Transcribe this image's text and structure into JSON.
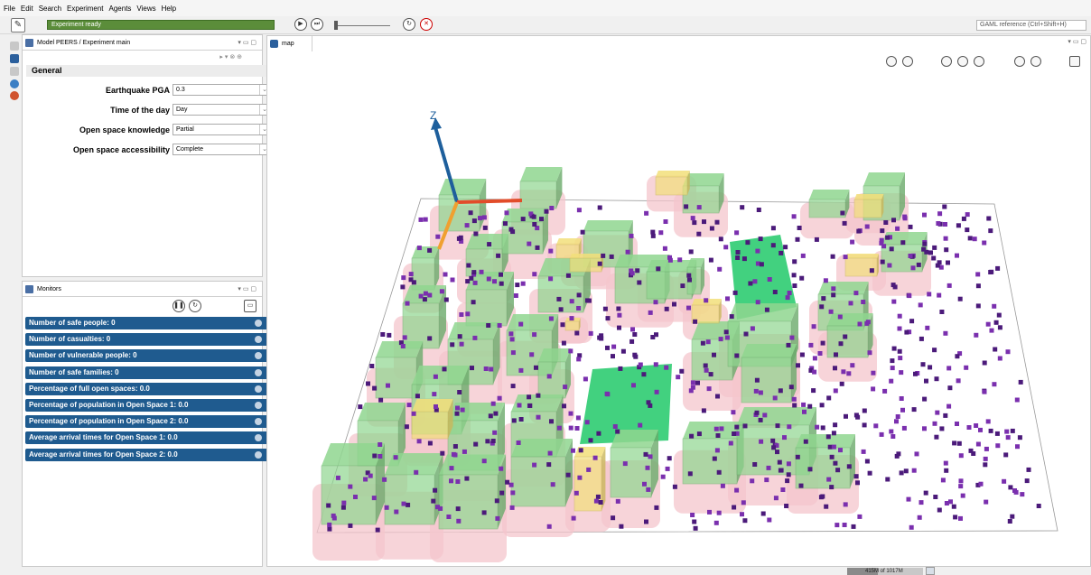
{
  "menubar": [
    "File",
    "Edit",
    "Search",
    "Experiment",
    "Agents",
    "Views",
    "Help"
  ],
  "toolbar": {
    "status": "Experiment ready",
    "search_placeholder": "GAML reference (Ctrl+Shift+H)"
  },
  "params_panel": {
    "title": "Model PEERS / Experiment main",
    "section": "General",
    "params": [
      {
        "label": "Earthquake PGA",
        "value": "0.3"
      },
      {
        "label": "Time of the day",
        "value": "Day"
      },
      {
        "label": "Open space knowledge",
        "value": "Partial"
      },
      {
        "label": "Open space accessibility",
        "value": "Complete"
      }
    ]
  },
  "monitors_panel": {
    "title": "Monitors",
    "items": [
      "Number of safe people:  0",
      "Number of casualties:  0",
      "Number of vulnerable people:  0",
      "Number of safe families:  0",
      "Percentage of full open spaces:  0.0",
      "Percentage of population in Open Space 1:  0.0",
      "Percentage of population in Open Space 2:  0.0",
      "Average arrival times for Open Space 1:  0.0",
      "Average arrival times for Open Space 2:  0.0"
    ]
  },
  "map": {
    "tab_label": "map",
    "axis_label": "Z"
  },
  "memory": {
    "text": "415M of 1017M",
    "fraction": 0.41
  },
  "colors": {
    "status_green": "#5b8d3a",
    "monitor_blue": "#1f5b8f",
    "building_green": "#8fd68f",
    "open_space": "#2ecc71",
    "people_purple": "#4b1a7a",
    "buffer_pink": "#f4c6cc",
    "axis_blue": "#1e5f9c"
  }
}
